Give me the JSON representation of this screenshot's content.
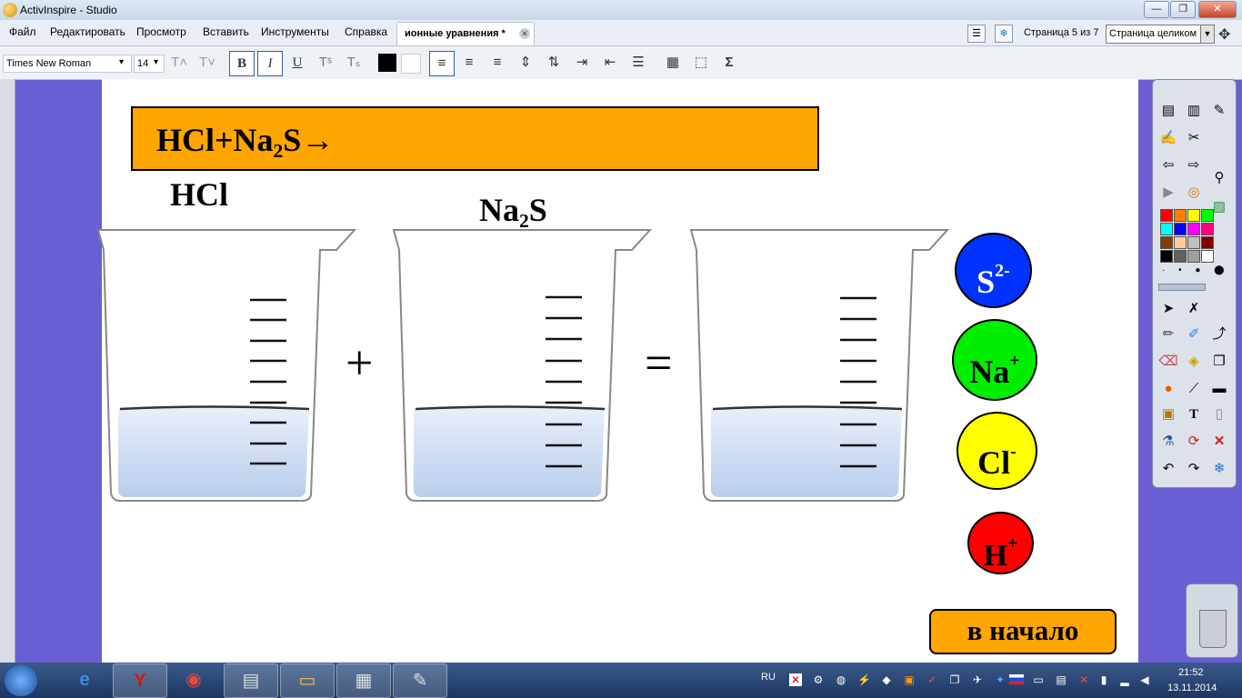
{
  "window": {
    "title": "ActivInspire - Studio",
    "min": "—",
    "max": "❐",
    "close": "✕"
  },
  "menu": [
    "Файл",
    "Редактировать",
    "Просмотр",
    "Вставить",
    "Инструменты",
    "Справка"
  ],
  "document_tab": {
    "label": "ионные уравнения *",
    "close": "✕"
  },
  "page_indicator": "Страница 5 из 7",
  "zoom": {
    "value": "Страница целиком",
    "arrow": "▼"
  },
  "format_toolbar": {
    "font": "Times New Roman",
    "size": "14",
    "dropdown_arrow": "▾",
    "bold": "B",
    "italic": "I",
    "underline": "U",
    "sigma": "Σ"
  },
  "slide": {
    "formula": "HCl+Na₂S→",
    "label_hcl": "HCl",
    "label_na2s": "Na₂S",
    "plus": "+",
    "equals": "=",
    "ions": [
      {
        "base": "S",
        "charge": "2-",
        "color": "#0033ff",
        "text_color": "#ffffff"
      },
      {
        "base": "Na",
        "charge": "+",
        "color": "#00ee00",
        "text_color": "#000000"
      },
      {
        "base": "Cl",
        "charge": "-",
        "color": "#ffff00",
        "text_color": "#000000"
      },
      {
        "base": "H",
        "charge": "+",
        "color": "#ff0000",
        "text_color": "#000000"
      }
    ],
    "start_button": "в начало"
  },
  "palette_colors": [
    "#ff0000",
    "#ff8000",
    "#ffff00",
    "#00ff00",
    "#00ffff",
    "#0000ff",
    "#ff00ff",
    "#ff0080",
    "#804000",
    "#ffcc99",
    "#c0c0c0",
    "#800000",
    "#000000",
    "#606060",
    "#a0a0a0",
    "#ffffff"
  ],
  "taskbar": {
    "lang": "RU",
    "time": "21:52",
    "date": "13.11.2014"
  }
}
